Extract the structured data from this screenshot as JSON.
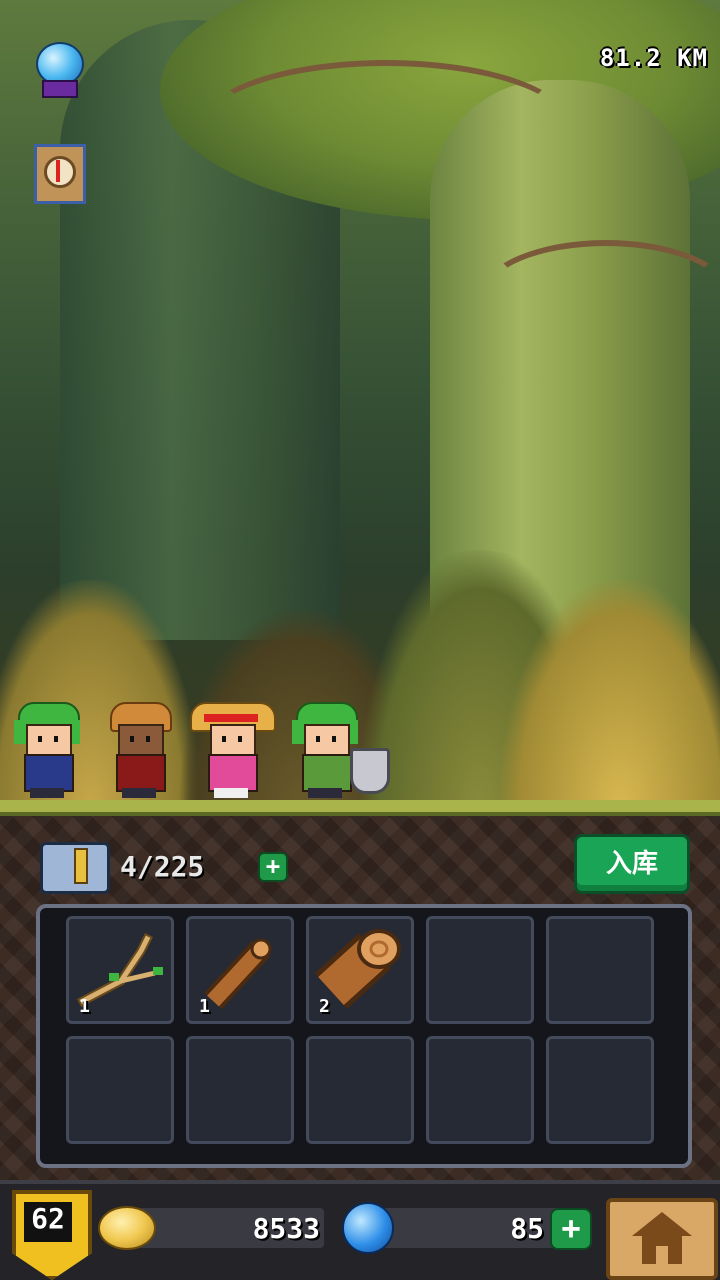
{
  "hud": {
    "distance": "81.2 KM",
    "icons": [
      "crystal-ball-icon",
      "compass-icon"
    ]
  },
  "party": [
    {
      "name": "hero-green-hat",
      "hat_color": "#3fb63f"
    },
    {
      "name": "hero-blond",
      "hat_color": "#d08a3a"
    },
    {
      "name": "hero-straw-hat",
      "hat_color": "#e8b048"
    },
    {
      "name": "hero-green-hat-2",
      "hat_color": "#3fb63f"
    }
  ],
  "inventory": {
    "capacity": "4/225",
    "store_label": "入库",
    "add_label": "+",
    "items": [
      {
        "icon": "branch-icon",
        "qty": "1"
      },
      {
        "icon": "wood-stick-icon",
        "qty": "1"
      },
      {
        "icon": "log-icon",
        "qty": "2"
      }
    ]
  },
  "bottom_bar": {
    "level": "62",
    "coins": "8533",
    "gems": "85",
    "gem_add_label": "+"
  },
  "colors": {
    "accent_green": "#1aa455",
    "gold": "#f0c020",
    "gem_blue": "#2e8ee8"
  }
}
